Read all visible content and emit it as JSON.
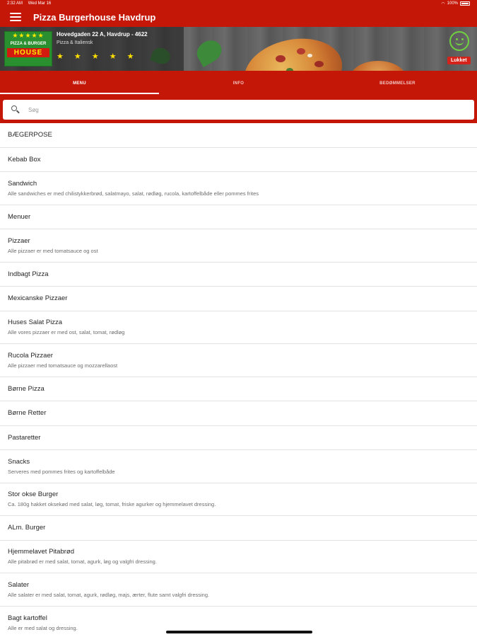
{
  "status_bar": {
    "time": "2:32 AM",
    "date": "Wed Mar 16",
    "battery": "100%"
  },
  "app": {
    "title": "Pizza Burgerhouse Havdrup"
  },
  "restaurant": {
    "address": "Hovedgaden 22 A, Havdrup - 4622",
    "category": "Pizza & Italiensk",
    "rating_stars": "★ ★ ★ ★ ★",
    "status": "Lukket",
    "logo": {
      "stars": "★★★★★",
      "line1": "PIZZA & BURGER",
      "line2": "HOUSE"
    }
  },
  "tabs": [
    {
      "label": "MENU",
      "active": true
    },
    {
      "label": "INFO",
      "active": false
    },
    {
      "label": "BEDØMMELSER",
      "active": false
    }
  ],
  "search": {
    "placeholder": "Søg",
    "value": ""
  },
  "menu_items": [
    {
      "title": "BÆGERPOSE",
      "desc": ""
    },
    {
      "title": "Kebab Box",
      "desc": ""
    },
    {
      "title": "Sandwich",
      "desc": "Alle sandwiches er med chilistykkerbrød, salatmayo, salat, rødløg, rucola, kartoffelbåde eller pommes frites"
    },
    {
      "title": "Menuer",
      "desc": ""
    },
    {
      "title": "Pizzaer",
      "desc": "Alle pizzaer er med tomatsauce og ost"
    },
    {
      "title": "Indbagt Pizza",
      "desc": ""
    },
    {
      "title": "Mexicanske Pizzaer",
      "desc": ""
    },
    {
      "title": "Huses Salat Pizza",
      "desc": "Alle vores pizzaer er med ost, salat, tomat, rødløg"
    },
    {
      "title": "Rucola Pizzaer",
      "desc": "Alle pizzaer med tomatsauce og mozzarellaost"
    },
    {
      "title": "Børne Pizza",
      "desc": ""
    },
    {
      "title": "Børne Retter",
      "desc": ""
    },
    {
      "title": "Pastaretter",
      "desc": ""
    },
    {
      "title": "Snacks",
      "desc": "Serveres med pommes frites og kartoffelbåde"
    },
    {
      "title": "Stor okse Burger",
      "desc": "Ca. 180g hakket oksekød med salat, løg, tomat, friske agurker og hjemmelavet dressing."
    },
    {
      "title": "ALm. Burger",
      "desc": ""
    },
    {
      "title": "Hjemmelavet Pitabrød",
      "desc": "Alle pitabrød er med salat, tomat, agurk, løg og valgfri dressing."
    },
    {
      "title": "Salater",
      "desc": "Alle salater er med salat, tomat, agurk, rødløg, majs, ærter, flute samt valgfri dressing."
    },
    {
      "title": "Bagt kartoffel",
      "desc": "Alle er med salat og dressing."
    }
  ]
}
